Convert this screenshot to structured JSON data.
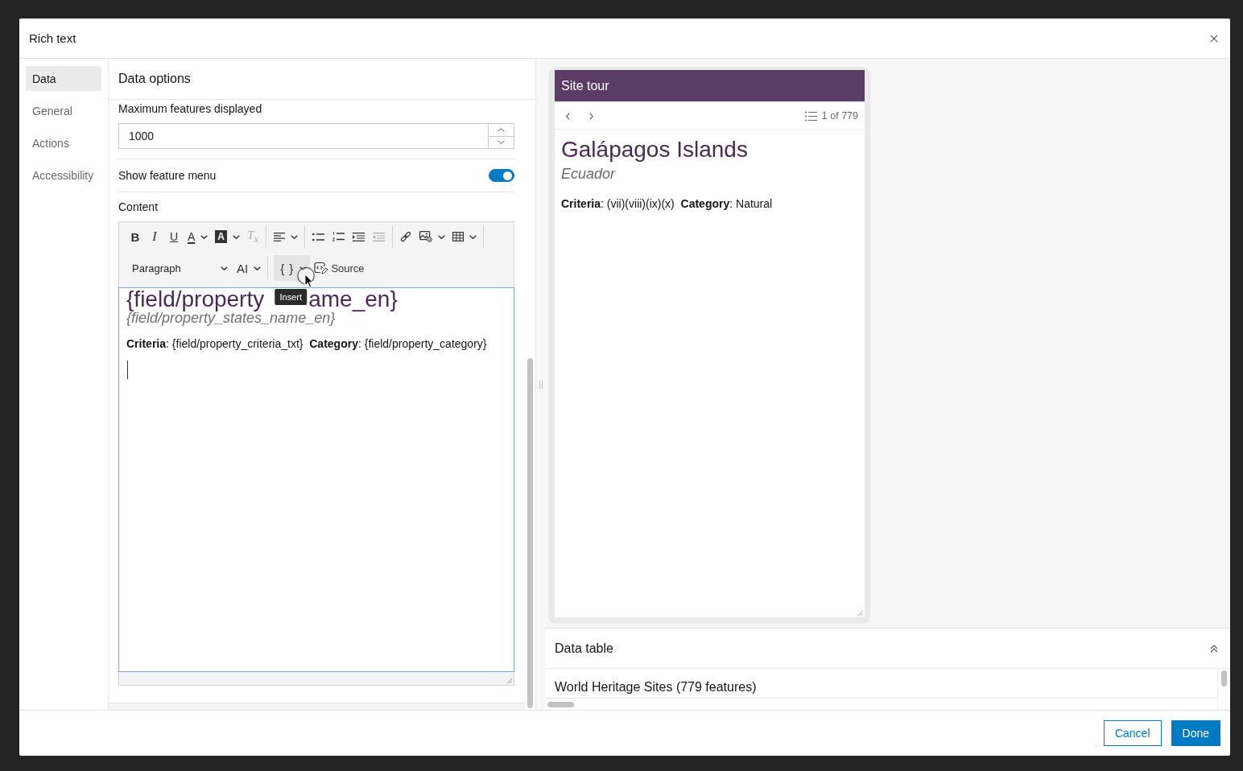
{
  "window": {
    "title": "Rich text"
  },
  "nav": [
    {
      "label": "Data",
      "selected": true
    },
    {
      "label": "General",
      "selected": false
    },
    {
      "label": "Actions",
      "selected": false
    },
    {
      "label": "Accessibility",
      "selected": false
    }
  ],
  "data_options": {
    "title": "Data options",
    "max_features": {
      "label": "Maximum features displayed",
      "value": "1000"
    },
    "feature_menu": {
      "label": "Show feature menu",
      "on": true
    },
    "content": {
      "label": "Content",
      "toolbar": {
        "rows": [
          [
            [
              {
                "kind": "bold",
                "label": "B",
                "disabled": false,
                "dropdown": false,
                "hovered": false
              },
              {
                "kind": "italic",
                "label": "I",
                "disabled": false,
                "dropdown": false,
                "hovered": false
              },
              {
                "kind": "underline",
                "label": "U",
                "disabled": false,
                "dropdown": false,
                "hovered": false
              },
              {
                "kind": "font-color",
                "label": "A",
                "disabled": false,
                "dropdown": true,
                "hovered": false
              },
              {
                "kind": "highlight",
                "label": "A",
                "disabled": false,
                "dropdown": true,
                "hovered": false
              },
              {
                "kind": "clear-format",
                "label": "T$_{x}$",
                "disabled": true,
                "dropdown": false,
                "hovered": false
              }
            ],
            [
              {
                "kind": "align",
                "disabled": false,
                "dropdown": true,
                "hovered": false
              }
            ],
            [
              {
                "kind": "bullets",
                "disabled": false,
                "dropdown": false,
                "hovered": false
              },
              {
                "kind": "numbers",
                "disabled": false,
                "dropdown": false,
                "hovered": false
              },
              {
                "kind": "indent",
                "disabled": false,
                "dropdown": false,
                "hovered": false
              },
              {
                "kind": "outdent",
                "disabled": true,
                "dropdown": false,
                "hovered": false
              }
            ],
            [
              {
                "kind": "link",
                "disabled": false,
                "dropdown": false,
                "hovered": false
              },
              {
                "kind": "image",
                "disabled": false,
                "dropdown": true,
                "hovered": false
              },
              {
                "kind": "table",
                "disabled": false,
                "dropdown": true,
                "hovered": false
              }
            ]
          ],
          [
            [
              {
                "kind": "select",
                "label": "Paragraph",
                "disabled": false,
                "dropdown": true,
                "hovered": false
              },
              {
                "kind": "font-size",
                "label": "AI",
                "disabled": false,
                "dropdown": true,
                "hovered": false
              }
            ],
            [
              {
                "kind": "insert",
                "label": "{ }",
                "disabled": false,
                "dropdown": true,
                "hovered": true,
                "tooltip": "Insert"
              },
              {
                "kind": "source",
                "label": "Source",
                "disabled": false,
                "dropdown": false,
                "hovered": false
              }
            ]
          ]
        ]
      },
      "editor": {
        "heading": [
          "{field/property",
          "ame_en}"
        ],
        "subheading": "{field/property_states_name_en}",
        "details": "**Criteria**: {field/property_criteria_txt}  **Category**: {field/property_category}"
      }
    }
  },
  "preview": {
    "title": "Site tour",
    "pager": "1 of 779",
    "heading": "Galápagos Islands",
    "subheading": "Ecuador",
    "details": "**Criteria**: (vii)(viii)(ix)(x)  **Category**: Natural"
  },
  "data_table": {
    "title": "Data table",
    "layer": "World Heritage Sites (779 features)"
  },
  "buttons": [
    {
      "label": "Cancel",
      "kind": "secondary"
    },
    {
      "label": "Done",
      "kind": "primary"
    }
  ]
}
